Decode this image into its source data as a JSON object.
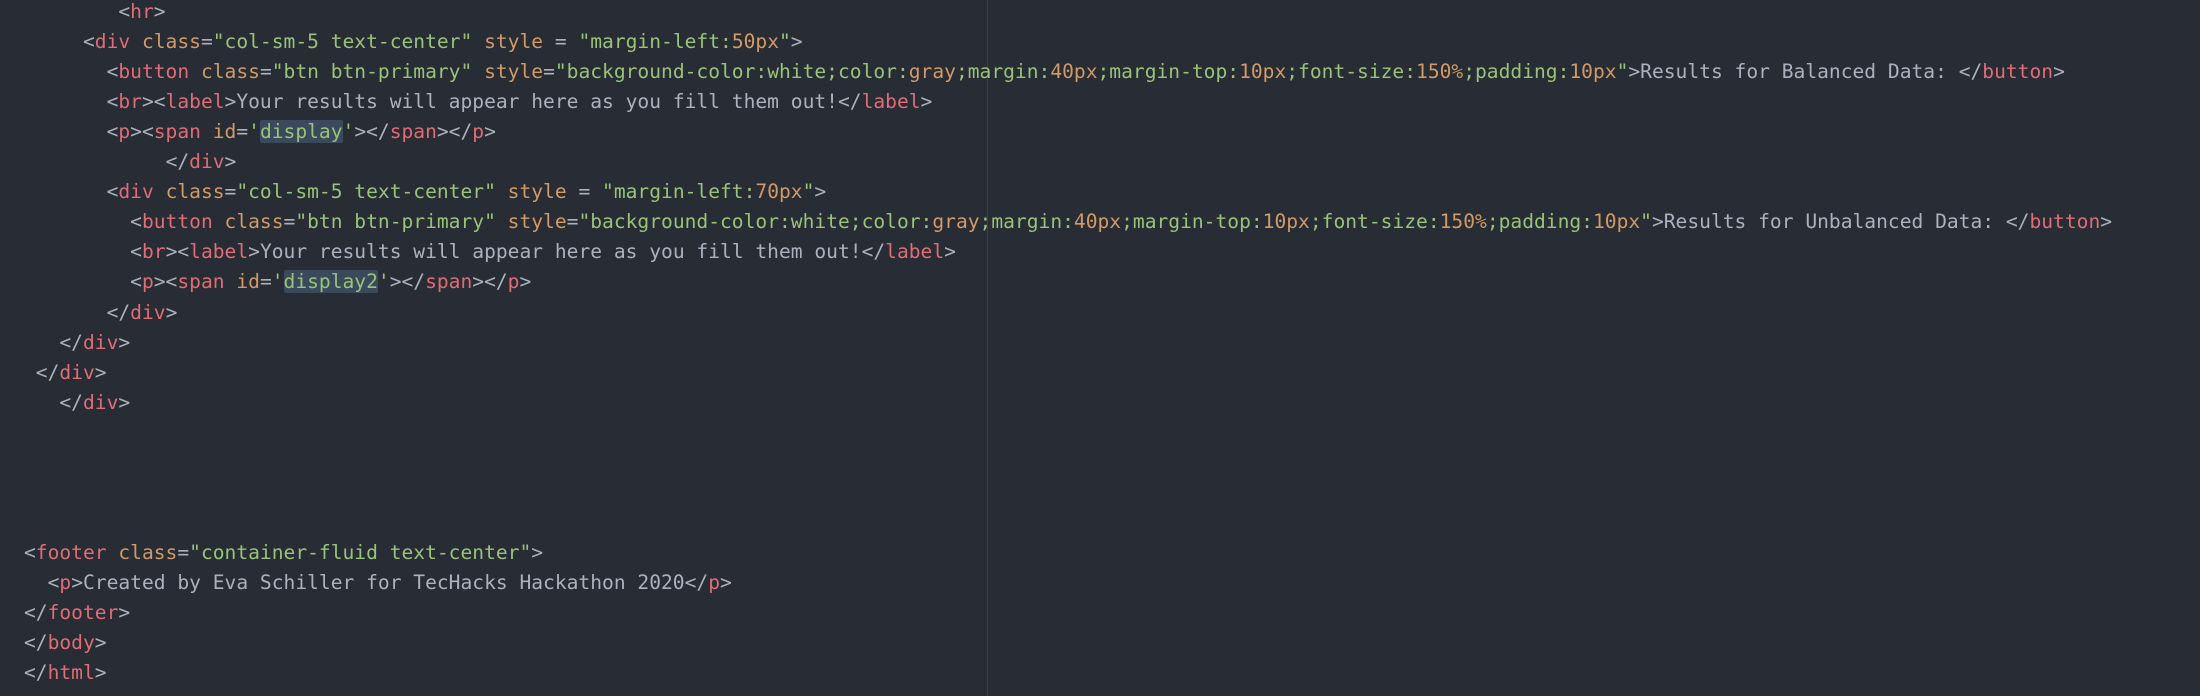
{
  "editor": {
    "theme_colors": {
      "background": "#282c34",
      "tag": "#e06c75",
      "attribute": "#d19a66",
      "string": "#98c379",
      "number": "#d19a66",
      "text": "#abb2bf",
      "highlight": "#3a4a5c",
      "wrap_guide": "#3b4048"
    },
    "lines": [
      {
        "indent": "        ",
        "tokens": [
          [
            "punct",
            "<"
          ],
          [
            "tag",
            "hr"
          ],
          [
            "punct",
            ">"
          ]
        ]
      },
      {
        "indent": "     ",
        "tokens": [
          [
            "punct",
            "<"
          ],
          [
            "tag",
            "div"
          ],
          [
            "punct",
            " "
          ],
          [
            "attr",
            "class"
          ],
          [
            "punct",
            "="
          ],
          [
            "str",
            "\"col-sm-5 text-center\""
          ],
          [
            "punct",
            " "
          ],
          [
            "attr",
            "style"
          ],
          [
            "punct",
            " = "
          ],
          [
            "str",
            "\"margin-left:"
          ],
          [
            "num",
            "50px"
          ],
          [
            "str",
            "\""
          ],
          [
            "punct",
            ">"
          ]
        ]
      },
      {
        "indent": "       ",
        "tokens": [
          [
            "punct",
            "<"
          ],
          [
            "tag",
            "button"
          ],
          [
            "punct",
            " "
          ],
          [
            "attr",
            "class"
          ],
          [
            "punct",
            "="
          ],
          [
            "str",
            "\"btn btn-primary\""
          ],
          [
            "punct",
            " "
          ],
          [
            "attr",
            "style"
          ],
          [
            "punct",
            "="
          ],
          [
            "str",
            "\"background-color:white;color:"
          ],
          [
            "num",
            "gray"
          ],
          [
            "str",
            ";margin:"
          ],
          [
            "num",
            "40px"
          ],
          [
            "str",
            ";margin-top:"
          ],
          [
            "num",
            "10px"
          ],
          [
            "str",
            ";font-size:"
          ],
          [
            "num",
            "150%"
          ],
          [
            "str",
            ";padding:"
          ],
          [
            "num",
            "10px"
          ],
          [
            "str",
            "\""
          ],
          [
            "punct",
            ">"
          ],
          [
            "text",
            "Results for Balanced Data: "
          ],
          [
            "punct",
            "</"
          ],
          [
            "tag",
            "button"
          ],
          [
            "punct",
            ">"
          ]
        ]
      },
      {
        "indent": "       ",
        "tokens": [
          [
            "punct",
            "<"
          ],
          [
            "tag",
            "br"
          ],
          [
            "punct",
            "><"
          ],
          [
            "tag",
            "label"
          ],
          [
            "punct",
            ">"
          ],
          [
            "text",
            "Your results will appear here as you fill them out!"
          ],
          [
            "punct",
            "</"
          ],
          [
            "tag",
            "label"
          ],
          [
            "punct",
            ">"
          ]
        ]
      },
      {
        "indent": "       ",
        "tokens": [
          [
            "punct",
            "<"
          ],
          [
            "tag",
            "p"
          ],
          [
            "punct",
            "><"
          ],
          [
            "tag",
            "span"
          ],
          [
            "punct",
            " "
          ],
          [
            "attr",
            "id"
          ],
          [
            "punct",
            "="
          ],
          [
            "str",
            "'"
          ],
          [
            "hl",
            "display"
          ],
          [
            "str",
            "'"
          ],
          [
            "punct",
            "></"
          ],
          [
            "tag",
            "span"
          ],
          [
            "punct",
            "></"
          ],
          [
            "tag",
            "p"
          ],
          [
            "punct",
            ">"
          ]
        ]
      },
      {
        "indent": "            ",
        "tokens": [
          [
            "punct",
            "</"
          ],
          [
            "tag",
            "div"
          ],
          [
            "punct",
            ">"
          ]
        ]
      },
      {
        "indent": "       ",
        "tokens": [
          [
            "punct",
            "<"
          ],
          [
            "tag",
            "div"
          ],
          [
            "punct",
            " "
          ],
          [
            "attr",
            "class"
          ],
          [
            "punct",
            "="
          ],
          [
            "str",
            "\"col-sm-5 text-center\""
          ],
          [
            "punct",
            " "
          ],
          [
            "attr",
            "style"
          ],
          [
            "punct",
            " = "
          ],
          [
            "str",
            "\"margin-left:"
          ],
          [
            "num",
            "70px"
          ],
          [
            "str",
            "\""
          ],
          [
            "punct",
            ">"
          ]
        ]
      },
      {
        "indent": "         ",
        "tokens": [
          [
            "punct",
            "<"
          ],
          [
            "tag",
            "button"
          ],
          [
            "punct",
            " "
          ],
          [
            "attr",
            "class"
          ],
          [
            "punct",
            "="
          ],
          [
            "str",
            "\"btn btn-primary\""
          ],
          [
            "punct",
            " "
          ],
          [
            "attr",
            "style"
          ],
          [
            "punct",
            "="
          ],
          [
            "str",
            "\"background-color:white;color:"
          ],
          [
            "num",
            "gray"
          ],
          [
            "str",
            ";margin:"
          ],
          [
            "num",
            "40px"
          ],
          [
            "str",
            ";margin-top:"
          ],
          [
            "num",
            "10px"
          ],
          [
            "str",
            ";font-size:"
          ],
          [
            "num",
            "150%"
          ],
          [
            "str",
            ";padding:"
          ],
          [
            "num",
            "10px"
          ],
          [
            "str",
            "\""
          ],
          [
            "punct",
            ">"
          ],
          [
            "text",
            "Results for Unbalanced Data: "
          ],
          [
            "punct",
            "</"
          ],
          [
            "tag",
            "button"
          ],
          [
            "punct",
            ">"
          ]
        ]
      },
      {
        "indent": "         ",
        "tokens": [
          [
            "punct",
            "<"
          ],
          [
            "tag",
            "br"
          ],
          [
            "punct",
            "><"
          ],
          [
            "tag",
            "label"
          ],
          [
            "punct",
            ">"
          ],
          [
            "text",
            "Your results will appear here as you fill them out!"
          ],
          [
            "punct",
            "</"
          ],
          [
            "tag",
            "label"
          ],
          [
            "punct",
            ">"
          ]
        ]
      },
      {
        "indent": "         ",
        "tokens": [
          [
            "punct",
            "<"
          ],
          [
            "tag",
            "p"
          ],
          [
            "punct",
            "><"
          ],
          [
            "tag",
            "span"
          ],
          [
            "punct",
            " "
          ],
          [
            "attr",
            "id"
          ],
          [
            "punct",
            "="
          ],
          [
            "str",
            "'"
          ],
          [
            "hl",
            "display2"
          ],
          [
            "str",
            "'"
          ],
          [
            "punct",
            "></"
          ],
          [
            "tag",
            "span"
          ],
          [
            "punct",
            "></"
          ],
          [
            "tag",
            "p"
          ],
          [
            "punct",
            ">"
          ]
        ]
      },
      {
        "indent": "       ",
        "tokens": [
          [
            "punct",
            "</"
          ],
          [
            "tag",
            "div"
          ],
          [
            "punct",
            ">"
          ]
        ]
      },
      {
        "indent": "   ",
        "tokens": [
          [
            "punct",
            "</"
          ],
          [
            "tag",
            "div"
          ],
          [
            "punct",
            ">"
          ]
        ]
      },
      {
        "indent": " ",
        "tokens": [
          [
            "punct",
            "</"
          ],
          [
            "tag",
            "div"
          ],
          [
            "punct",
            ">"
          ]
        ]
      },
      {
        "indent": "   ",
        "tokens": [
          [
            "punct",
            "</"
          ],
          [
            "tag",
            "div"
          ],
          [
            "punct",
            ">"
          ]
        ]
      },
      {
        "indent": "",
        "tokens": []
      },
      {
        "indent": "",
        "tokens": []
      },
      {
        "indent": "",
        "tokens": []
      },
      {
        "indent": "",
        "tokens": []
      },
      {
        "indent": "",
        "tokens": [
          [
            "punct",
            "<"
          ],
          [
            "tag",
            "footer"
          ],
          [
            "punct",
            " "
          ],
          [
            "attr",
            "class"
          ],
          [
            "punct",
            "="
          ],
          [
            "str",
            "\"container-fluid text-center\""
          ],
          [
            "punct",
            ">"
          ]
        ]
      },
      {
        "indent": "  ",
        "tokens": [
          [
            "punct",
            "<"
          ],
          [
            "tag",
            "p"
          ],
          [
            "punct",
            ">"
          ],
          [
            "text",
            "Created by Eva Schiller for TecHacks Hackathon 2020"
          ],
          [
            "punct",
            "</"
          ],
          [
            "tag",
            "p"
          ],
          [
            "punct",
            ">"
          ]
        ]
      },
      {
        "indent": "",
        "tokens": [
          [
            "punct",
            "</"
          ],
          [
            "tag",
            "footer"
          ],
          [
            "punct",
            ">"
          ]
        ]
      },
      {
        "indent": "",
        "tokens": [
          [
            "punct",
            "</"
          ],
          [
            "tag",
            "body"
          ],
          [
            "punct",
            ">"
          ]
        ]
      },
      {
        "indent": "",
        "tokens": [
          [
            "punct",
            "</"
          ],
          [
            "tag",
            "html"
          ],
          [
            "punct",
            ">"
          ]
        ]
      }
    ]
  }
}
